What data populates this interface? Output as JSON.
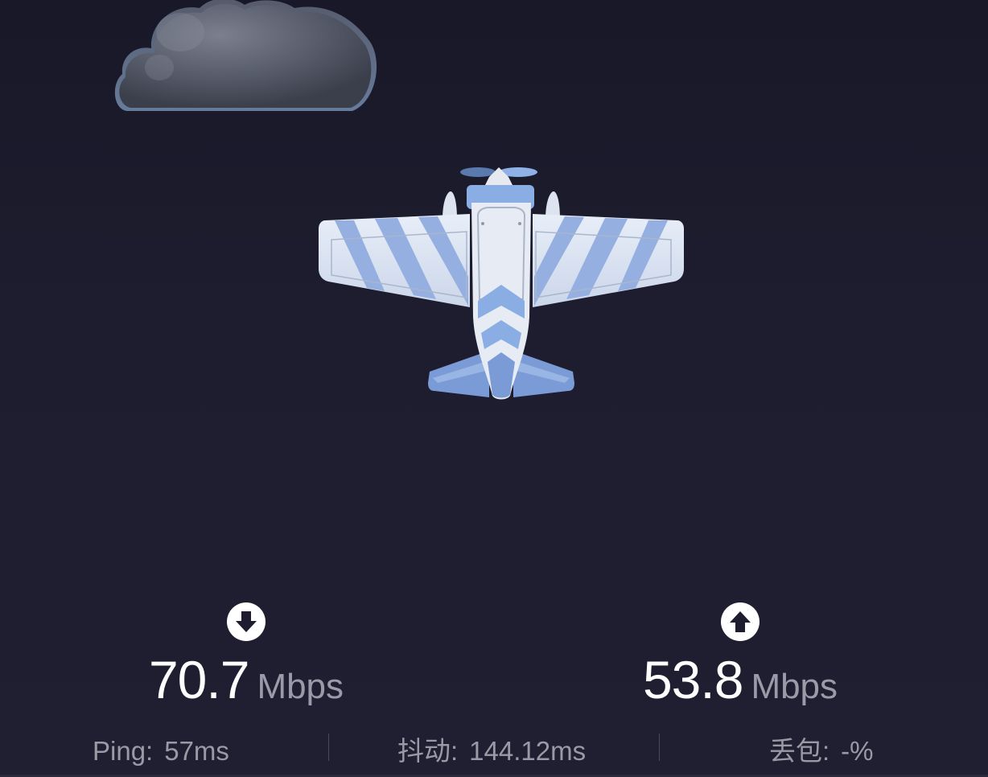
{
  "download": {
    "icon": "download-arrow-icon",
    "value": "70.7",
    "unit": "Mbps"
  },
  "upload": {
    "icon": "upload-arrow-icon",
    "value": "53.8",
    "unit": "Mbps"
  },
  "stats": {
    "ping": {
      "label": "Ping:",
      "value": "57ms"
    },
    "jitter": {
      "label": "抖动:",
      "value": "144.12ms"
    },
    "loss": {
      "label": "丢包:",
      "value": "-%"
    }
  },
  "illustrations": {
    "cloud": "cloud-icon",
    "plane": "airplane-icon"
  },
  "colors": {
    "background": "#1d1d2f",
    "plane_light": "#dfe6f3",
    "plane_blue": "#7ea0d8",
    "value_text": "#ffffff",
    "muted_text": "#9a9aa6"
  }
}
